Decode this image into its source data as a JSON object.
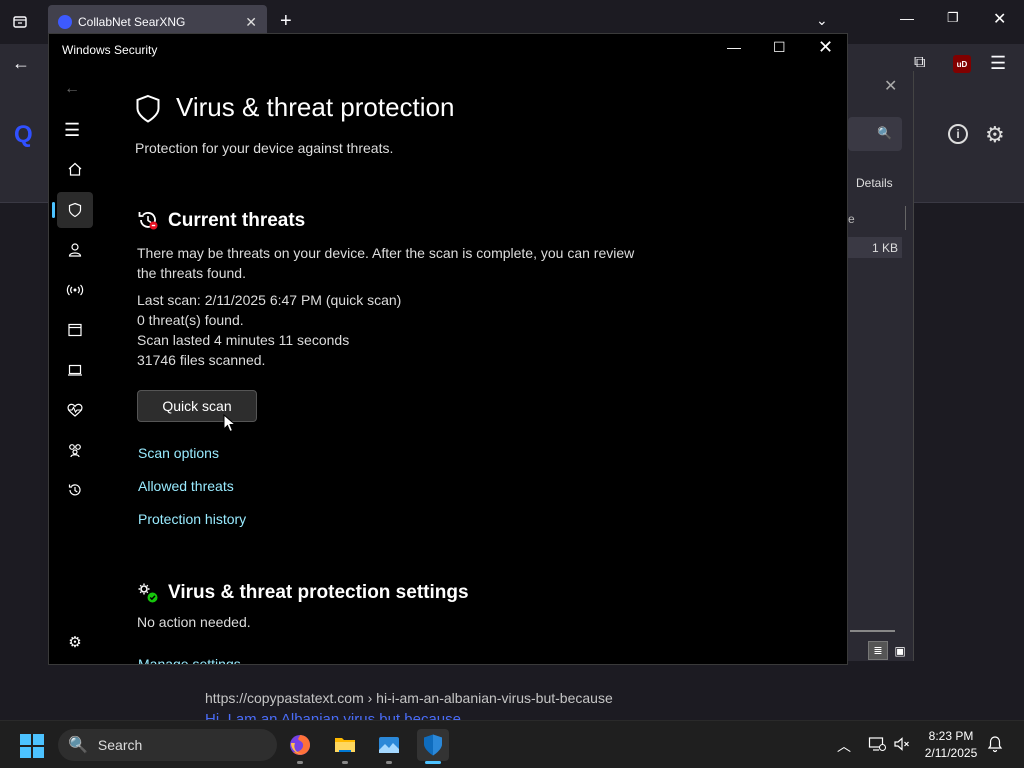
{
  "browser": {
    "tab_title": "CollabNet SearXNG",
    "tab_close": "✕",
    "new_tab": "+",
    "tabs_menu": "⌄",
    "window_controls": {
      "minimize": "—",
      "maximize": "❐",
      "close": "✕"
    },
    "back": "←",
    "puzzle": "⧉",
    "ublock": "uD",
    "menu": "☰",
    "logo": "Q",
    "info": "i",
    "settings": "⚙",
    "bg_dialog": {
      "close": "✕",
      "search_icon": "🔍",
      "details_label": "Details",
      "column_fragment": "e",
      "size_value": "1 KB",
      "view_list": "≣",
      "view_preview": "▣"
    },
    "result_url": "https://copypastatext.com  › hi-i-am-an-albanian-virus-but-because",
    "result_link": "Hi, I am an Albanian virus but because"
  },
  "security": {
    "window_title": "Windows Security",
    "controls": {
      "minimize": "—",
      "maximize": "☐",
      "close": "✕"
    },
    "nav": {
      "back": "←",
      "menu": "☰",
      "items": [
        {
          "name": "home-icon",
          "glyph": "⌂"
        },
        {
          "name": "shield-icon",
          "glyph": "⛉"
        },
        {
          "name": "account-icon",
          "glyph": "⚇"
        },
        {
          "name": "network-icon",
          "glyph": "((•))"
        },
        {
          "name": "app-browser-icon",
          "glyph": "▭"
        },
        {
          "name": "device-security-icon",
          "glyph": "💻"
        },
        {
          "name": "health-icon",
          "glyph": "♡"
        },
        {
          "name": "family-icon",
          "glyph": "⚉"
        },
        {
          "name": "history-icon",
          "glyph": "↺"
        }
      ],
      "settings": "⚙"
    },
    "page_title": "Virus & threat protection",
    "page_subtitle": "Protection for your device against threats.",
    "current_threats": {
      "title": "Current threats",
      "description": "There may be threats on your device. After the scan is complete, you can review the threats found.",
      "last_scan": "Last scan: 2/11/2025 6:47 PM (quick scan)",
      "threats_found": "0 threat(s) found.",
      "duration": "Scan lasted 4 minutes 11 seconds",
      "files_scanned": "31746 files scanned.",
      "quick_scan_label": "Quick scan",
      "links": {
        "scan_options": "Scan options",
        "allowed_threats": "Allowed threats",
        "protection_history": "Protection history"
      }
    },
    "settings_section": {
      "title": "Virus & threat protection settings",
      "status": "No action needed.",
      "manage_link": "Manage settings"
    }
  },
  "taskbar": {
    "search_label": "Search",
    "search_icon": "🔍",
    "tray": {
      "chevron": "︿",
      "network": "🖵",
      "volume": "🔈",
      "time": "8:23 PM",
      "date": "2/11/2025",
      "bell": "🔔"
    }
  }
}
